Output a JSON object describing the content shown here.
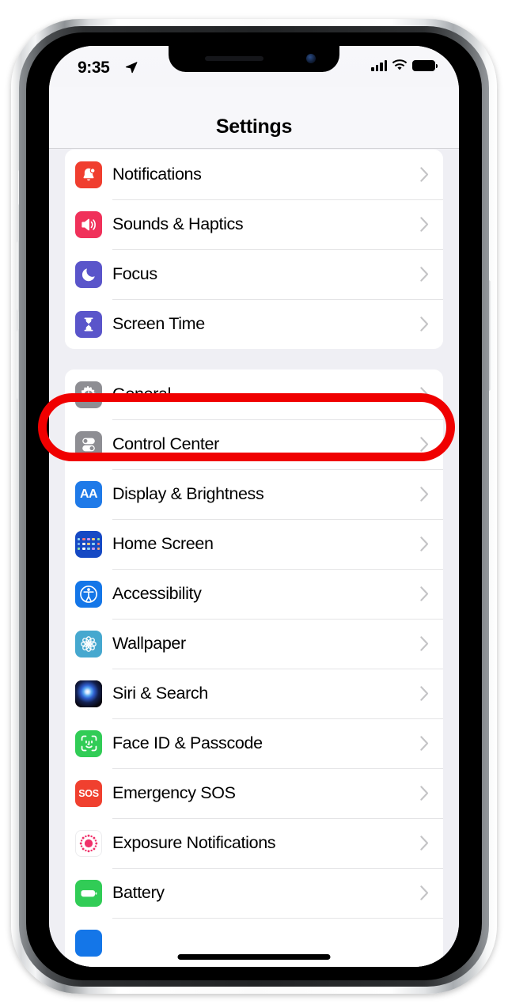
{
  "status_bar": {
    "time": "9:35",
    "location_icon": "location-arrow-icon",
    "cellular_icon": "cellular-bars-icon",
    "wifi_icon": "wifi-icon",
    "battery_icon": "battery-full-icon"
  },
  "nav": {
    "title": "Settings"
  },
  "annotation": {
    "type": "oval-highlight",
    "target": "General",
    "color": "#f00000"
  },
  "groups": [
    {
      "rows": [
        {
          "label": "Notifications",
          "icon": "bell-badge-icon",
          "icon_class": "ic-notifications",
          "chevron": true
        },
        {
          "label": "Sounds & Haptics",
          "icon": "speaker-waves-icon",
          "icon_class": "ic-sounds",
          "chevron": true
        },
        {
          "label": "Focus",
          "icon": "moon-icon",
          "icon_class": "ic-focus",
          "chevron": true
        },
        {
          "label": "Screen Time",
          "icon": "hourglass-icon",
          "icon_class": "ic-screentime",
          "chevron": true
        }
      ]
    },
    {
      "rows": [
        {
          "label": "General",
          "icon": "gear-icon",
          "icon_class": "ic-general",
          "chevron": true,
          "highlighted": true
        },
        {
          "label": "Control Center",
          "icon": "toggles-icon",
          "icon_class": "ic-controlcenter",
          "chevron": true
        },
        {
          "label": "Display & Brightness",
          "icon": "aa-text-size-icon",
          "icon_class": "ic-display",
          "chevron": true,
          "glyph_text": "AA"
        },
        {
          "label": "Home Screen",
          "icon": "app-grid-icon",
          "icon_class": "ic-homescreen",
          "chevron": true
        },
        {
          "label": "Accessibility",
          "icon": "accessibility-icon",
          "icon_class": "ic-accessibility",
          "chevron": true
        },
        {
          "label": "Wallpaper",
          "icon": "flower-wallpaper-icon",
          "icon_class": "ic-wallpaper",
          "chevron": true
        },
        {
          "label": "Siri & Search",
          "icon": "siri-orb-icon",
          "icon_class": "ic-siri",
          "chevron": true
        },
        {
          "label": "Face ID & Passcode",
          "icon": "face-id-icon",
          "icon_class": "ic-faceid",
          "chevron": true
        },
        {
          "label": "Emergency SOS",
          "icon": "sos-icon",
          "icon_class": "ic-sos",
          "chevron": true,
          "glyph_text": "SOS"
        },
        {
          "label": "Exposure Notifications",
          "icon": "exposure-dots-icon",
          "icon_class": "ic-exposure",
          "chevron": true
        },
        {
          "label": "Battery",
          "icon": "battery-icon",
          "icon_class": "ic-battery",
          "chevron": true
        }
      ]
    }
  ],
  "colors": {
    "screen_background": "#efeff4",
    "card_background": "#ffffff",
    "separator": "#e4e4e6",
    "chevron": "#c4c4c6",
    "label_text": "#000000",
    "annotation_red": "#f00000"
  }
}
